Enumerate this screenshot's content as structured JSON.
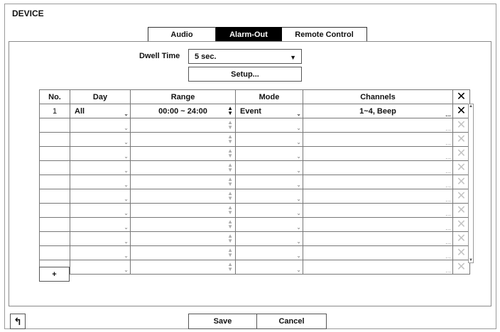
{
  "title": "DEVICE",
  "tabs": [
    {
      "label": "Audio",
      "active": false
    },
    {
      "label": "Alarm-Out",
      "active": true
    },
    {
      "label": "Remote Control",
      "active": false
    }
  ],
  "dwell": {
    "label": "Dwell Time",
    "value": "5 sec."
  },
  "setup_label": "Setup...",
  "table": {
    "headers": [
      "No.",
      "Day",
      "Range",
      "Mode",
      "Channels"
    ],
    "rows": [
      {
        "no": "1",
        "day": "All",
        "range": "00:00 ~ 24:00",
        "mode": "Event",
        "channels": "1~4, Beep"
      }
    ],
    "empty_rows": 11
  },
  "add_label": "+",
  "footer": {
    "save_label": "Save",
    "cancel_label": "Cancel"
  },
  "icons": {
    "delete": "close-icon",
    "back": "back-arrow-icon",
    "dropdown": "chevron-down-icon"
  },
  "colors": {
    "active_tab_bg": "#000000",
    "inactive_delete": "#c4c4c4"
  }
}
